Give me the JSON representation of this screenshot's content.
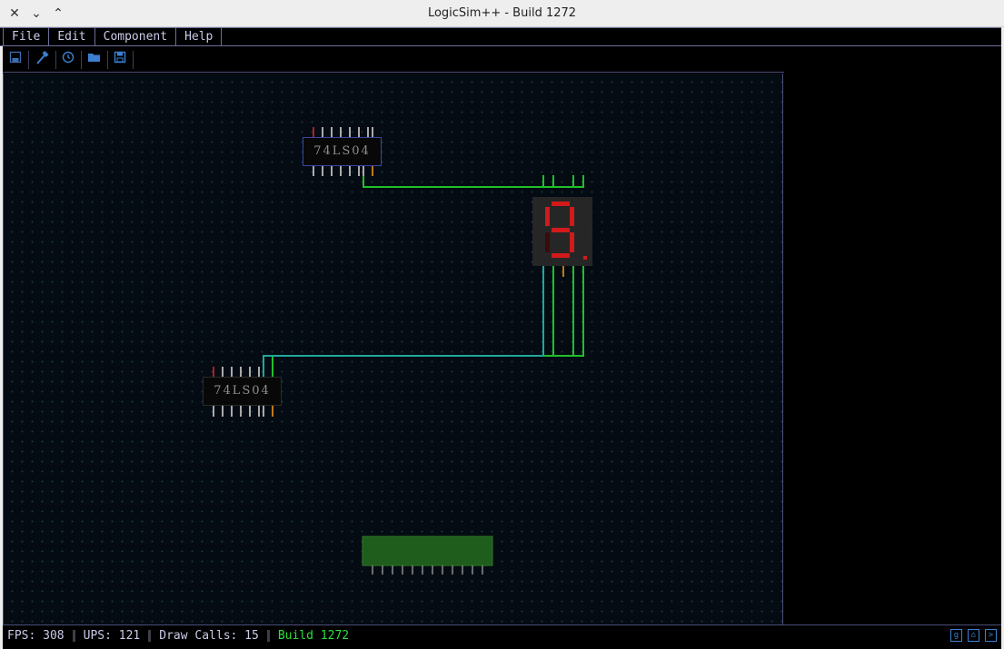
{
  "window": {
    "title": "LogicSim++ - Build 1272",
    "controls": [
      "close-icon",
      "minimize-icon",
      "maximize-icon"
    ]
  },
  "menu": {
    "items": [
      "File",
      "Edit",
      "Component",
      "Help"
    ]
  },
  "toolbar": {
    "tools": [
      "save-disk-icon",
      "hammer-icon",
      "history-icon",
      "open-folder-icon",
      "save-as-icon"
    ]
  },
  "canvas": {
    "chips": [
      {
        "label": "74LS04"
      },
      {
        "label": "74LS04"
      }
    ],
    "display": {
      "type": "seven-segment"
    }
  },
  "statusbar": {
    "fps_label": "FPS:",
    "fps": "308",
    "ups_label": "UPS:",
    "ups": "121",
    "draw_calls_label": "Draw Calls:",
    "draw_calls": "15",
    "build": "Build 1272"
  },
  "colors": {
    "wire_green": "#1fbf2a",
    "wire_teal": "#1fa89a",
    "segment_on": "#d11a1a",
    "segment_off": "#3a0b0b",
    "ic_green": "#1e5d1c",
    "accent_blue": "#3d7fd0"
  }
}
